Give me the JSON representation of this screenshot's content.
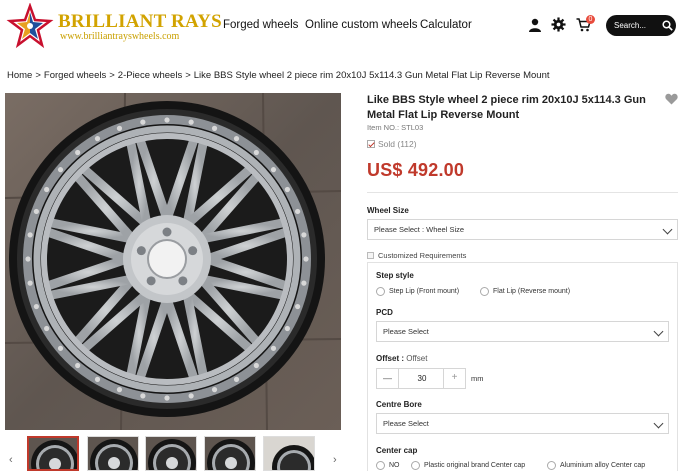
{
  "header": {
    "brand_name": "BRILLIANT RAYS",
    "brand_url": "www.brilliantrayswheels.com",
    "nav": [
      "Forged wheels",
      "Online custom wheels",
      "Calculator"
    ],
    "cart_count": "0",
    "search_placeholder": "Search...",
    "icons": [
      "user-icon",
      "gear-icon",
      "cart-icon",
      "search-icon"
    ],
    "brand_color": "#d2a300"
  },
  "breadcrumb": [
    "Home",
    "Forged wheels",
    "2-Piece wheels",
    "Like BBS Style wheel 2 piece rim 20x10J 5x114.3 Gun Metal Flat Lip Reverse Mount"
  ],
  "breadcrumb_separator": ">",
  "gallery": {
    "prev": "‹",
    "next": "›",
    "thumb_count": 5,
    "active_thumb": 1
  },
  "product": {
    "title": "Like BBS Style wheel 2 piece rim 20x10J 5x114.3 Gun Metal Flat Lip Reverse Mount",
    "item_no": "Item NO.: STL03",
    "sold": "Sold (112)",
    "price": "US$ 492.00",
    "price_color": "#c0392b"
  },
  "options": {
    "wheel_size_label": "Wheel Size",
    "wheel_size_value": "Please Select : Wheel Size",
    "custom_req_label": "Customized Requirements",
    "step_style_label": "Step style",
    "step_style_options": [
      "Step Lip (Front mount)",
      "Flat Lip (Reverse mount)"
    ],
    "pcd_label": "PCD",
    "pcd_value": "Please Select",
    "offset_label": "Offset :",
    "offset_hint": "Offset",
    "offset_minus": "—",
    "offset_value": "30",
    "offset_plus": "+",
    "offset_unit": "mm",
    "centre_bore_label": "Centre Bore",
    "centre_bore_value": "Please Select",
    "center_cap_label": "Center cap",
    "center_cap_options": [
      "NO",
      "Plastic original brand Center cap",
      "Aluminium alloy Center cap"
    ]
  }
}
